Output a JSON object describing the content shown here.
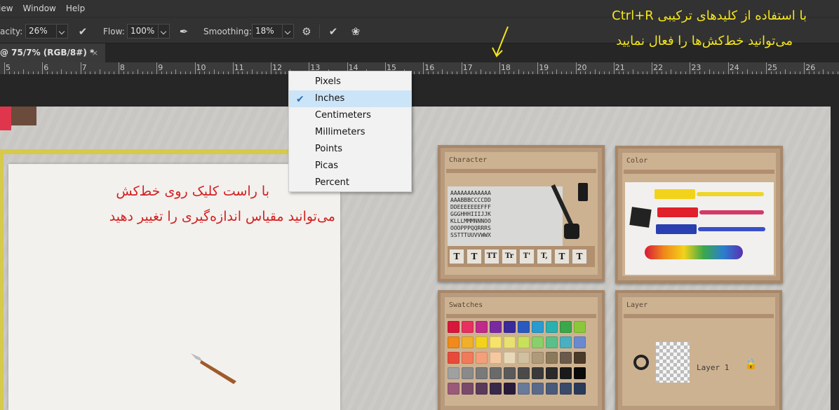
{
  "menubar": {
    "items": [
      "iew",
      "Window",
      "Help"
    ]
  },
  "options": {
    "opacity_label": "acity:",
    "opacity_value": "26%",
    "flow_label": "Flow:",
    "flow_value": "100%",
    "smoothing_label": "Smoothing:",
    "smoothing_value": "18%",
    "icons": [
      "pressure-opacity-icon",
      "airbrush-icon",
      "gear-icon",
      "pressure-size-icon",
      "symmetry-butterfly-icon"
    ]
  },
  "document": {
    "tab_title": "@ 75/7% (RGB/8#) *",
    "close_label": "×"
  },
  "ruler": {
    "labels": [
      "5",
      "6",
      "7",
      "8",
      "9",
      "10",
      "11",
      "12",
      "13",
      "14",
      "15",
      "16",
      "17",
      "18",
      "19",
      "20",
      "21",
      "22",
      "23",
      "24",
      "25",
      "26"
    ]
  },
  "context_menu": {
    "items": [
      {
        "label": "Pixels",
        "checked": false
      },
      {
        "label": "Inches",
        "checked": true
      },
      {
        "label": "Centimeters",
        "checked": false
      },
      {
        "label": "Millimeters",
        "checked": false
      },
      {
        "label": "Points",
        "checked": false
      },
      {
        "label": "Picas",
        "checked": false
      },
      {
        "label": "Percent",
        "checked": false
      }
    ]
  },
  "annotations": {
    "top_line1": "با استفاده از کلیدهای ترکیبی Ctrl+R",
    "top_line2": "می‌توانید خط‌کش‌ها را فعال نمایید",
    "side_line1": "با راست کلیک روی خط‌کش",
    "side_line2": "می‌توانید مقیاس اندازه‌گیری را تغییر دهید",
    "top_color": "#f5e61a",
    "side_color": "#d41f1f"
  },
  "boxes": {
    "character": {
      "label": "Character",
      "letters": "AAAAAAAAAAAA\nAAABBBCCCCDD\nDDEEEEEEEFFF\nGGGHHHIIIJJK\nKLLLMMMNNNOO\nOOOPPPQQRRRS\nSSTTTUUVVWWX",
      "tiles": [
        "T",
        "T",
        "TT",
        "Tr",
        "T'",
        "T,",
        "T",
        "T"
      ]
    },
    "color": {
      "label": "Color"
    },
    "swatches": {
      "label": "Swatches"
    },
    "layer": {
      "label": "Layer",
      "layer_name": "Layer 1"
    }
  }
}
